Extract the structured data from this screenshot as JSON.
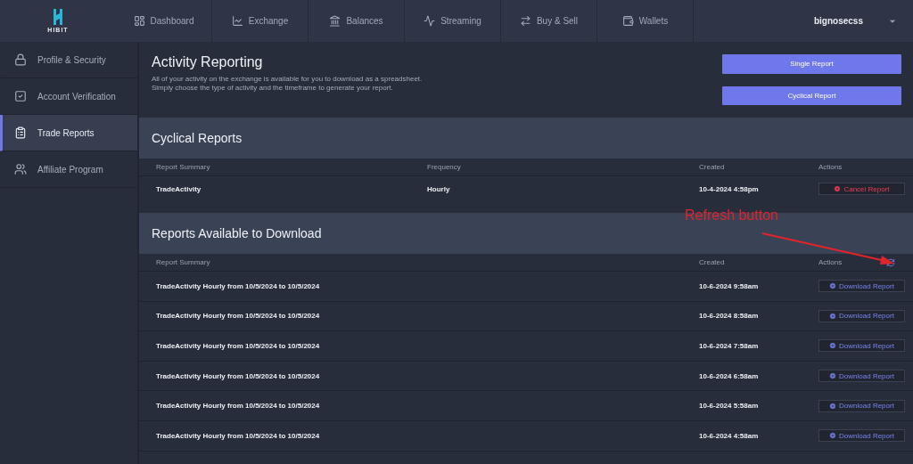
{
  "brand": {
    "name": "HIBIT"
  },
  "nav": [
    {
      "label": "Dashboard"
    },
    {
      "label": "Exchange"
    },
    {
      "label": "Balances"
    },
    {
      "label": "Streaming"
    },
    {
      "label": "Buy & Sell"
    },
    {
      "label": "Wallets"
    }
  ],
  "user": {
    "name": "bignosecss"
  },
  "sidebar": {
    "items": [
      {
        "label": "Profile & Security",
        "selected": false
      },
      {
        "label": "Account Verification",
        "selected": false
      },
      {
        "label": "Trade Reports",
        "selected": true
      },
      {
        "label": "Affiliate Program",
        "selected": false
      }
    ]
  },
  "intro": {
    "title": "Activity Reporting",
    "description": [
      "All of your activity on the exchange is available for you to download as a spreadsheet.",
      "Simply choose the type of activity and the timeframe to generate your report."
    ],
    "buttons": [
      "Single Report",
      "Cyclical Report"
    ]
  },
  "cyclical": {
    "title": "Cyclical Reports",
    "columns": [
      "Report Summary",
      "Frequency",
      "Created",
      "Actions"
    ],
    "rows": [
      {
        "summary": "TradeActivity",
        "frequency": "Hourly",
        "created": "10-4-2024 4:58pm",
        "action": "Cancel Report"
      }
    ]
  },
  "downloads": {
    "title": "Reports Available to Download",
    "columns": [
      "Report Summary",
      "Created",
      "Actions"
    ],
    "rows": [
      {
        "summary": "TradeActivity Hourly from 10/5/2024 to 10/5/2024",
        "created": "10-6-2024 9:58am",
        "action": "Download Report"
      },
      {
        "summary": "TradeActivity Hourly from 10/5/2024 to 10/5/2024",
        "created": "10-6-2024 8:58am",
        "action": "Download Report"
      },
      {
        "summary": "TradeActivity Hourly from 10/5/2024 to 10/5/2024",
        "created": "10-6-2024 7:58am",
        "action": "Download Report"
      },
      {
        "summary": "TradeActivity Hourly from 10/5/2024 to 10/5/2024",
        "created": "10-6-2024 6:58am",
        "action": "Download Report"
      },
      {
        "summary": "TradeActivity Hourly from 10/5/2024 to 10/5/2024",
        "created": "10-6-2024 5:58am",
        "action": "Download Report"
      },
      {
        "summary": "TradeActivity Hourly from 10/5/2024 to 10/5/2024",
        "created": "10-6-2024 4:58am",
        "action": "Download Report"
      }
    ]
  },
  "annotation": {
    "text": "Refresh button"
  }
}
